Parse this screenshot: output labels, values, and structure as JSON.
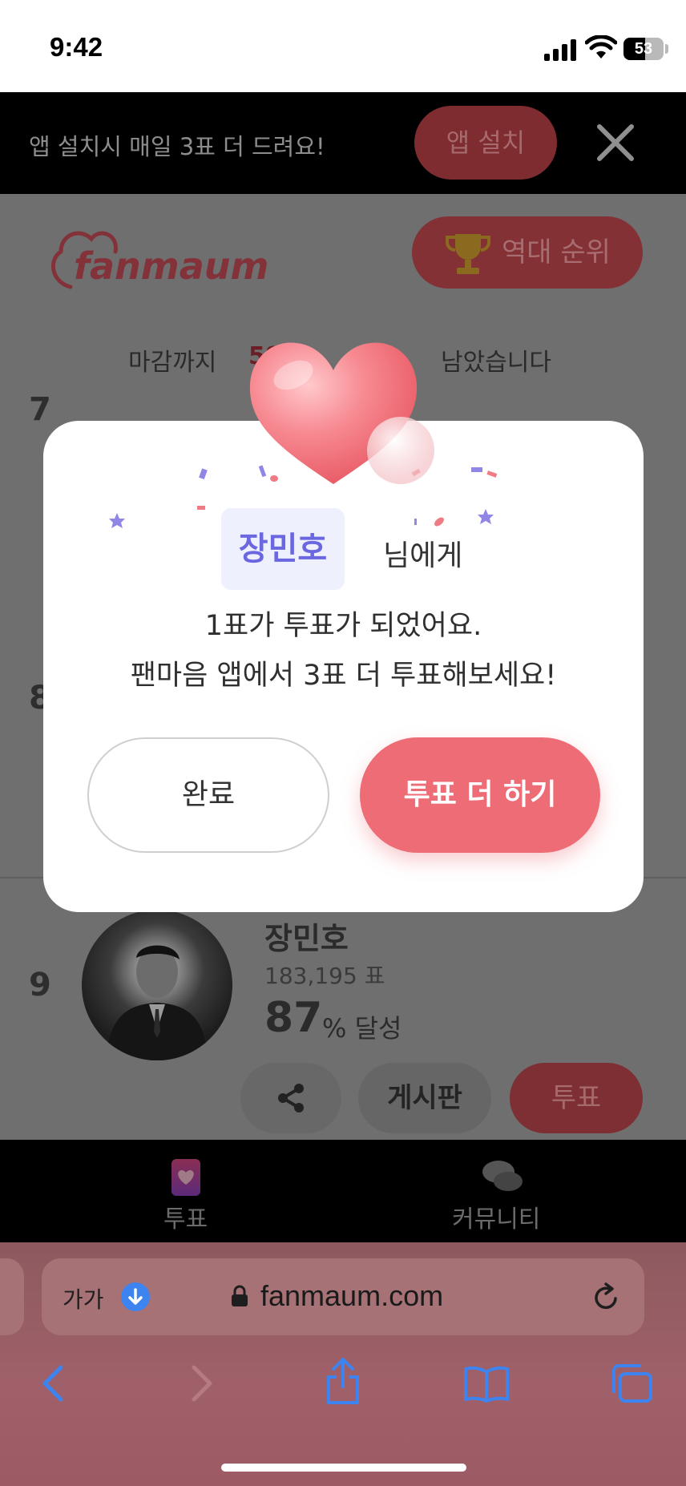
{
  "status_bar": {
    "time": "9:42",
    "battery": "53"
  },
  "promo": {
    "text": "앱 설치시 매일 3표 더 드려요!",
    "install_label": "앱 설치"
  },
  "header": {
    "logo": "fanmaum",
    "rank_label": "역대 순위"
  },
  "deadline": {
    "prefix": "마감까지",
    "countdown": "58",
    "suffix": "남았습니다"
  },
  "ranking": {
    "visible_ranks": [
      "7",
      "8"
    ],
    "entry": {
      "rank": "9",
      "name": "장민호",
      "votes": "183,195 표",
      "percent": "87",
      "percent_unit": "% 달성",
      "board_label": "게시판",
      "vote_label": "투표"
    }
  },
  "modal": {
    "name": "장민호",
    "name_suffix": "님에게",
    "line1": "1표가 투표가 되었어요.",
    "line2": "팬마음 앱에서 3표 더 투표해보세요!",
    "done_label": "완료",
    "more_label": "투표 더 하기"
  },
  "tabbar": {
    "vote": "투표",
    "community": "커뮤니티"
  },
  "browser": {
    "text_size": "가가",
    "url": "fanmaum.com"
  },
  "colors": {
    "accent": "#ee6c75",
    "name_chip": "#6a67e0",
    "download": "#3d84f0"
  }
}
